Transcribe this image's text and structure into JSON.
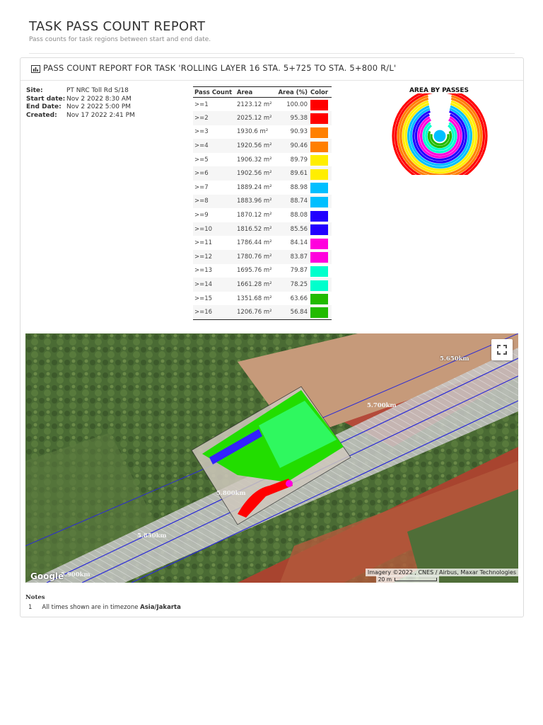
{
  "report": {
    "title": "TASK PASS COUNT REPORT",
    "subtitle": "Pass counts for task regions between start and end date."
  },
  "panel": {
    "title": "PASS COUNT REPORT FOR TASK 'ROLLING LAYER 16 STA. 5+725 TO STA. 5+800 R/L'",
    "icon": "bar-chart-icon"
  },
  "info": {
    "site_label": "Site:",
    "site_value": "PT NRC Toll Rd S/18",
    "start_label": "Start date:",
    "start_value": "Nov 2 2022 8:30 AM",
    "end_label": "End Date:",
    "end_value": "Nov 2 2022 5:00 PM",
    "created_label": "Created:",
    "created_value": "Nov 17 2022 2:41 PM"
  },
  "table": {
    "headers": [
      "Pass Count",
      "Area",
      "Area (%)",
      "Color"
    ],
    "rows": [
      {
        "pass": ">=1",
        "area": "2123.12 m²",
        "pct": "100.00",
        "color": "#ff0000"
      },
      {
        "pass": ">=2",
        "area": "2025.12 m²",
        "pct": "95.38",
        "color": "#ff0000"
      },
      {
        "pass": ">=3",
        "area": "1930.6 m²",
        "pct": "90.93",
        "color": "#ff7f00"
      },
      {
        "pass": ">=4",
        "area": "1920.56 m²",
        "pct": "90.46",
        "color": "#ff7f00"
      },
      {
        "pass": ">=5",
        "area": "1906.32 m²",
        "pct": "89.79",
        "color": "#ffee00"
      },
      {
        "pass": ">=6",
        "area": "1902.56 m²",
        "pct": "89.61",
        "color": "#ffee00"
      },
      {
        "pass": ">=7",
        "area": "1889.24 m²",
        "pct": "88.98",
        "color": "#00bfff"
      },
      {
        "pass": ">=8",
        "area": "1883.96 m²",
        "pct": "88.74",
        "color": "#00bfff"
      },
      {
        "pass": ">=9",
        "area": "1870.12 m²",
        "pct": "88.08",
        "color": "#2200ff"
      },
      {
        "pass": ">=10",
        "area": "1816.52 m²",
        "pct": "85.56",
        "color": "#2200ff"
      },
      {
        "pass": ">=11",
        "area": "1786.44 m²",
        "pct": "84.14",
        "color": "#ff00dd"
      },
      {
        "pass": ">=12",
        "area": "1780.76 m²",
        "pct": "83.87",
        "color": "#ff00dd"
      },
      {
        "pass": ">=13",
        "area": "1695.76 m²",
        "pct": "79.87",
        "color": "#00ffcc"
      },
      {
        "pass": ">=14",
        "area": "1661.28 m²",
        "pct": "78.25",
        "color": "#00ffcc"
      },
      {
        "pass": ">=15",
        "area": "1351.68 m²",
        "pct": "63.66",
        "color": "#22bb00"
      },
      {
        "pass": ">=16",
        "area": "1206.76 m²",
        "pct": "56.84",
        "color": "#22bb00"
      }
    ]
  },
  "chart_data": {
    "type": "pie",
    "title": "AREA BY PASSES",
    "categories": [
      ">=1",
      ">=2",
      ">=3",
      ">=4",
      ">=5",
      ">=6",
      ">=7",
      ">=8",
      ">=9",
      ">=10",
      ">=11",
      ">=12",
      ">=13",
      ">=14",
      ">=15",
      ">=16"
    ],
    "values": [
      100.0,
      95.38,
      90.93,
      90.46,
      89.79,
      89.61,
      88.98,
      88.74,
      88.08,
      85.56,
      84.14,
      83.87,
      79.87,
      78.25,
      63.66,
      56.84
    ],
    "colors": [
      "#ff0000",
      "#ff0000",
      "#ff7f00",
      "#ff7f00",
      "#ffee00",
      "#ffee00",
      "#00bfff",
      "#00bfff",
      "#2200ff",
      "#2200ff",
      "#ff00dd",
      "#ff00dd",
      "#00ffcc",
      "#00ffcc",
      "#22bb00",
      "#22bb00"
    ]
  },
  "map": {
    "km_labels": [
      "5.650km",
      "5.700km",
      "5.800km",
      "5.850km",
      "5.900km"
    ],
    "google": "Google",
    "attribution": "Imagery ©2022 , CNES / Airbus, Maxar Technologies",
    "scale": "20 m",
    "fullscreen_icon": "fullscreen-icon"
  },
  "notes": {
    "title": "Notes",
    "number": "1",
    "text": "All times shown are in timezone",
    "timezone": "Asia/Jakarta"
  }
}
